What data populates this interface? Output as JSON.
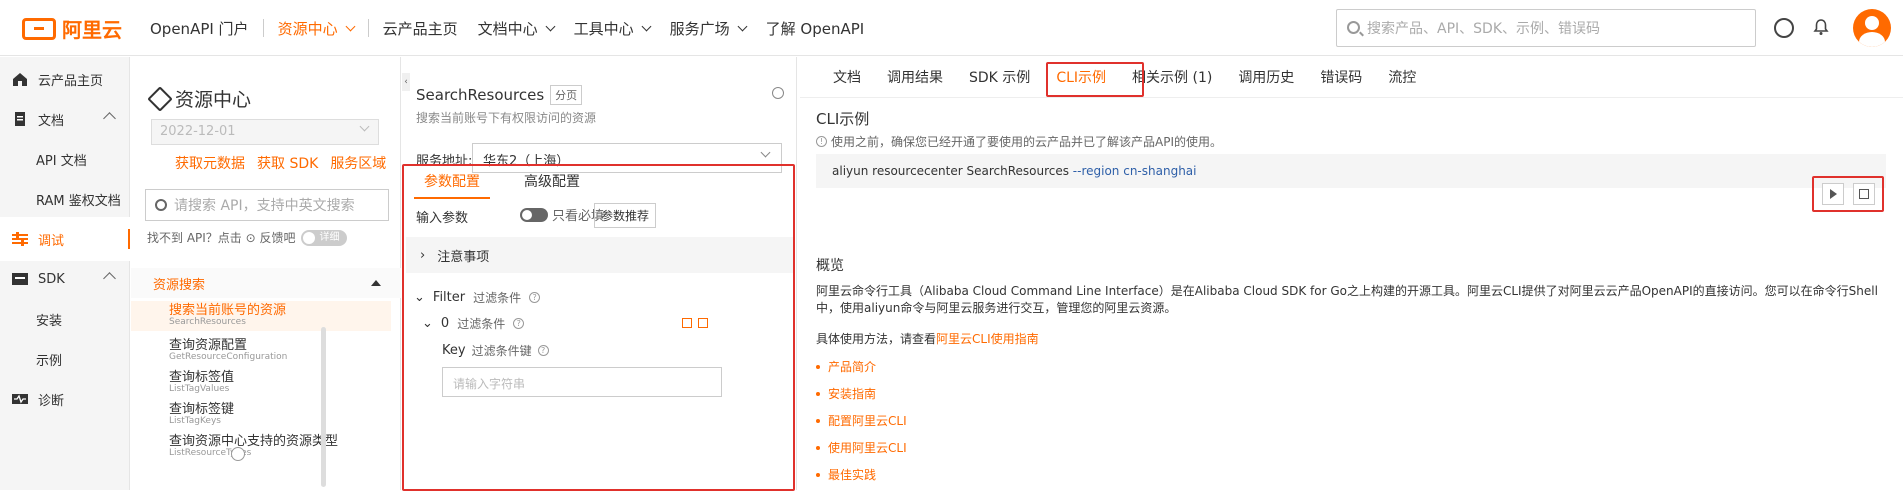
{
  "topbar": {
    "brand": "阿里云",
    "nav": [
      {
        "label": "OpenAPI 门户"
      },
      {
        "label": "资源中心",
        "active": true
      },
      {
        "label": "云产品主页"
      },
      {
        "label": "文档中心"
      },
      {
        "label": "工具中心"
      },
      {
        "label": "服务广场"
      },
      {
        "label": "了解 OpenAPI"
      }
    ],
    "search_placeholder": "搜索产品、API、SDK、示例、错误码"
  },
  "rail": {
    "items": [
      {
        "label": "云产品主页"
      },
      {
        "label": "文档"
      },
      {
        "label": "API 文档"
      },
      {
        "label": "RAM 鉴权文档"
      },
      {
        "label": "调试"
      },
      {
        "label": "SDK"
      },
      {
        "label": "安装"
      },
      {
        "label": "示例"
      },
      {
        "label": "诊断"
      }
    ]
  },
  "resource_panel": {
    "title": "资源中心",
    "version": "2022-12-01",
    "links": [
      "获取元数据",
      "获取 SDK",
      "服务区域"
    ],
    "search_placeholder": "请搜索 API，支持中英文搜索",
    "hint": "找不到 API？点击 ⊙ 反馈吧",
    "detail_toggle": "详细",
    "group": "资源搜索",
    "apis": [
      {
        "cn": "搜索当前账号的资源",
        "en": "SearchResources"
      },
      {
        "cn": "查询资源配置",
        "en": "GetResourceConfiguration"
      },
      {
        "cn": "查询标签值",
        "en": "ListTagValues"
      },
      {
        "cn": "查询标签键",
        "en": "ListTagKeys"
      },
      {
        "cn": "查询资源中心支持的资源类型",
        "en": "ListResourceTypes"
      }
    ]
  },
  "middle": {
    "api_name": "SearchResources",
    "paging_tag": "分页",
    "desc": "搜索当前账号下有权限访问的资源",
    "service_label": "服务地址:",
    "service_value": "华东2（上海）",
    "tabs": [
      "参数配置",
      "高级配置"
    ],
    "input_params": "输入参数",
    "required_only": "只看必填",
    "recommend": "参数推荐",
    "notes": "注意事项",
    "filter_label": "Filter",
    "filter_sub": "过滤条件",
    "cond_index": "0",
    "cond_sub": "过滤条件",
    "key_label": "Key",
    "key_sub": "过滤条件键",
    "key_placeholder": "请输入字符串"
  },
  "right": {
    "tabs": [
      "文档",
      "调用结果",
      "SDK 示例",
      "CLI示例",
      "相关示例 (1)",
      "调用历史",
      "错误码",
      "流控"
    ],
    "cli_title": "CLI示例",
    "cli_note": "使用之前，确保您已经开通了要使用的云产品并已了解该产品API的使用。",
    "cmd_main": "aliyun resourcecenter SearchResources ",
    "cmd_flag": "--region cn-shanghai",
    "overview_title": "概览",
    "overview_text": "阿里云命令行工具（Alibaba Cloud Command Line Interface）是在Alibaba Cloud SDK for Go之上构建的开源工具。阿里云CLI提供了对阿里云云产品OpenAPI的直接访问。您可以在命令行Shell中，使用aliyun命令与阿里云服务进行交互，管理您的阿里云资源。",
    "usage_prefix": "具体使用方法，请查看",
    "usage_link": "阿里云CLI使用指南",
    "bullets": [
      "产品简介",
      "安装指南",
      "配置阿里云CLI",
      "使用阿里云CLI",
      "最佳实践"
    ]
  },
  "colors": {
    "accent": "#ff6a00",
    "highlight_box": "#e0312c"
  }
}
